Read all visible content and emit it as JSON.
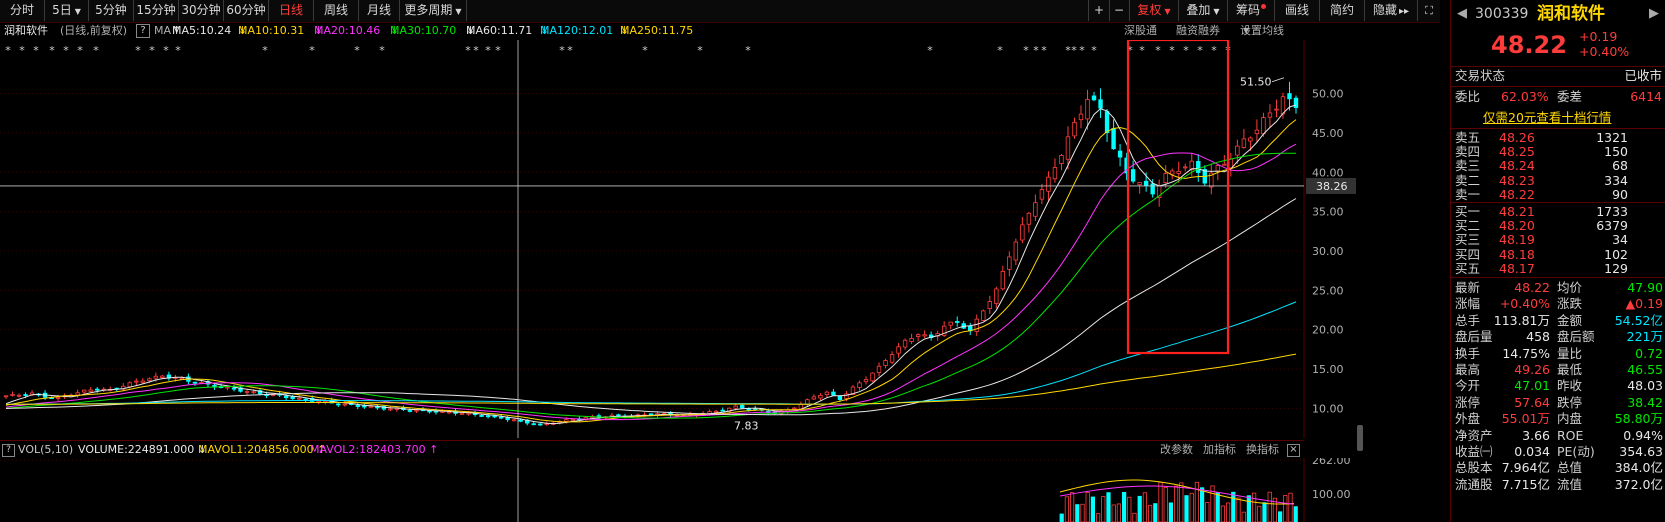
{
  "toolbar": {
    "items": [
      {
        "label": "分时",
        "active": false
      },
      {
        "label": "5日",
        "active": false,
        "dropdown": true
      },
      {
        "label": "5分钟",
        "active": false
      },
      {
        "label": "15分钟",
        "active": false
      },
      {
        "label": "30分钟",
        "active": false
      },
      {
        "label": "60分钟",
        "active": false
      },
      {
        "label": "日线",
        "active": true
      },
      {
        "label": "周线",
        "active": false
      },
      {
        "label": "月线",
        "active": false
      },
      {
        "label": "更多周期",
        "active": false,
        "dropdown": true
      }
    ],
    "right_items": [
      {
        "label": "+"
      },
      {
        "label": "−"
      },
      {
        "label": "复权",
        "dropdown": true,
        "active": true
      },
      {
        "label": "叠加",
        "dropdown": true
      },
      {
        "label": "筹码"
      },
      {
        "label": "画线"
      },
      {
        "label": "简约"
      },
      {
        "label": "隐藏"
      }
    ]
  },
  "chart_header": {
    "stock_name": "润和软件",
    "mode": "(日线,前复权)",
    "help": "?",
    "ma_label": "MA",
    "ma_items": [
      {
        "text": "MA5:10.24",
        "color": "#e8e8e8",
        "arrow": "↑"
      },
      {
        "text": "MA10:10.31",
        "color": "#ffd700",
        "arrow": "↓"
      },
      {
        "text": "MA20:10.46",
        "color": "#ff33ff",
        "arrow": "↓"
      },
      {
        "text": "MA30:10.70",
        "color": "#00e600",
        "arrow": "↓"
      },
      {
        "text": "MA60:11.71",
        "color": "#e8e8e8",
        "arrow": "↓"
      },
      {
        "text": "MA120:12.01",
        "color": "#00e5ff",
        "arrow": "↓"
      },
      {
        "text": "MA250:11.75",
        "color": "#ffd700",
        "arrow": "↓"
      }
    ],
    "right_links": [
      "深股通",
      "融资融券",
      "设置均线"
    ]
  },
  "chart_data": {
    "type": "line",
    "note": "Daily candlestick chart with moving averages",
    "y_ticks": [
      50.0,
      45.0,
      40.0,
      35.0,
      30.0,
      25.0,
      20.0,
      15.0,
      10.0
    ],
    "ylim": [
      7.0,
      53.5
    ],
    "crosshair_value": "38.26",
    "high_label": "51.50",
    "low_label": "7.83",
    "vol_y_ticks": [
      "262.00",
      "100.00"
    ],
    "series": [
      {
        "name": "MA5",
        "color": "#e8e8e8"
      },
      {
        "name": "MA10",
        "color": "#ffd700"
      },
      {
        "name": "MA20",
        "color": "#ff33ff"
      },
      {
        "name": "MA30",
        "color": "#00e600"
      },
      {
        "name": "MA60",
        "color": "#e8e8e8"
      },
      {
        "name": "MA120",
        "color": "#00e5ff"
      },
      {
        "name": "MA250",
        "color": "#ffd700"
      }
    ],
    "close": [
      11.6,
      11.7,
      11.9,
      11.5,
      11.3,
      11.8,
      12.2,
      12.5,
      12.3,
      12.9,
      13.4,
      13.8,
      14.1,
      13.9,
      13.5,
      13.2,
      12.8,
      12.6,
      12.3,
      12.0,
      11.8,
      11.6,
      11.3,
      11.1,
      10.9,
      10.7,
      10.5,
      10.3,
      10.2,
      10.0,
      9.9,
      9.8,
      9.7,
      9.6,
      9.5,
      9.4,
      9.2,
      9.0,
      8.8,
      8.5,
      8.2,
      7.9,
      8.2,
      8.5,
      8.7,
      8.9,
      9.0,
      9.1,
      9.0,
      9.2,
      9.3,
      9.2,
      9.1,
      9.3,
      9.5,
      9.8,
      10.2,
      10.0,
      9.7,
      9.4,
      9.8,
      10.5,
      11.5,
      12.0,
      11.2,
      12.6,
      13.8,
      15.2,
      17.0,
      18.5,
      19.5,
      18.9,
      20.5,
      21.0,
      19.8,
      22.5,
      25.0,
      29.5,
      33.0,
      36.5,
      39.0,
      42.5,
      46.0,
      49.5,
      48.0,
      43.0,
      40.0,
      38.5,
      37.5,
      39.5,
      40.5,
      41.0,
      39.0,
      40.5,
      42.0,
      44.0,
      45.5,
      47.5,
      49.5,
      48.22
    ]
  },
  "volume_header": {
    "label": "VOL(5,10)",
    "volume": "VOLUME:224891.000",
    "mavol1": "MAVOL1:204856.000",
    "mavol2": "MAVOL2:182403.700",
    "links": [
      "改参数",
      "加指标",
      "换指标"
    ]
  },
  "quote": {
    "code": "300339",
    "name": "润和软件",
    "price": "48.22",
    "change": "+0.19",
    "change_pct": "+0.40%",
    "trade_status_label": "交易状态",
    "trade_status": "已收市",
    "weibi_label": "委比",
    "weibi": "62.03%",
    "weicha_label": "委差",
    "weicha": "6414",
    "promo": "仅需20元查看十档行情",
    "asks": [
      {
        "label": "卖五",
        "price": "48.26",
        "vol": "1321"
      },
      {
        "label": "卖四",
        "price": "48.25",
        "vol": "150"
      },
      {
        "label": "卖三",
        "price": "48.24",
        "vol": "68"
      },
      {
        "label": "卖二",
        "price": "48.23",
        "vol": "334"
      },
      {
        "label": "卖一",
        "price": "48.22",
        "vol": "90"
      }
    ],
    "bids": [
      {
        "label": "买一",
        "price": "48.21",
        "vol": "1733"
      },
      {
        "label": "买二",
        "price": "48.20",
        "vol": "6379"
      },
      {
        "label": "买三",
        "price": "48.19",
        "vol": "34"
      },
      {
        "label": "买四",
        "price": "48.18",
        "vol": "102"
      },
      {
        "label": "买五",
        "price": "48.17",
        "vol": "129"
      }
    ],
    "stats": [
      {
        "l1": "最新",
        "v1": "48.22",
        "c1": "red",
        "l2": "均价",
        "v2": "47.90",
        "c2": "green"
      },
      {
        "l1": "涨幅",
        "v1": "+0.40%",
        "c1": "red",
        "l2": "涨跌",
        "v2": "▲0.19",
        "c2": "red"
      },
      {
        "l1": "总手",
        "v1": "113.81万",
        "c1": "white",
        "l2": "金额",
        "v2": "54.52亿",
        "c2": "cyan"
      },
      {
        "l1": "盘后量",
        "v1": "458",
        "c1": "white",
        "l2": "盘后额",
        "v2": "221万",
        "c2": "cyan"
      },
      {
        "l1": "换手",
        "v1": "14.75%",
        "c1": "white",
        "l2": "量比",
        "v2": "0.72",
        "c2": "green"
      },
      {
        "l1": "最高",
        "v1": "49.26",
        "c1": "red",
        "l2": "最低",
        "v2": "46.55",
        "c2": "green"
      },
      {
        "l1": "今开",
        "v1": "47.01",
        "c1": "green",
        "l2": "昨收",
        "v2": "48.03",
        "c2": "white"
      },
      {
        "l1": "涨停",
        "v1": "57.64",
        "c1": "red",
        "l2": "跌停",
        "v2": "38.42",
        "c2": "green"
      },
      {
        "l1": "外盘",
        "v1": "55.01万",
        "c1": "red",
        "l2": "内盘",
        "v2": "58.80万",
        "c2": "green"
      },
      {
        "l1": "净资产",
        "v1": "3.66",
        "c1": "white",
        "l2": "ROE",
        "v2": "0.94%",
        "c2": "white"
      },
      {
        "l1": "收益㈠",
        "v1": "0.034",
        "c1": "white",
        "l2": "PE(动)",
        "v2": "354.63",
        "c2": "white"
      },
      {
        "l1": "总股本",
        "v1": "7.964亿",
        "c1": "white",
        "l2": "总值",
        "v2": "384.0亿",
        "c2": "white"
      },
      {
        "l1": "流通股",
        "v1": "7.715亿",
        "c1": "white",
        "l2": "流值",
        "v2": "372.0亿",
        "c2": "white"
      }
    ]
  }
}
